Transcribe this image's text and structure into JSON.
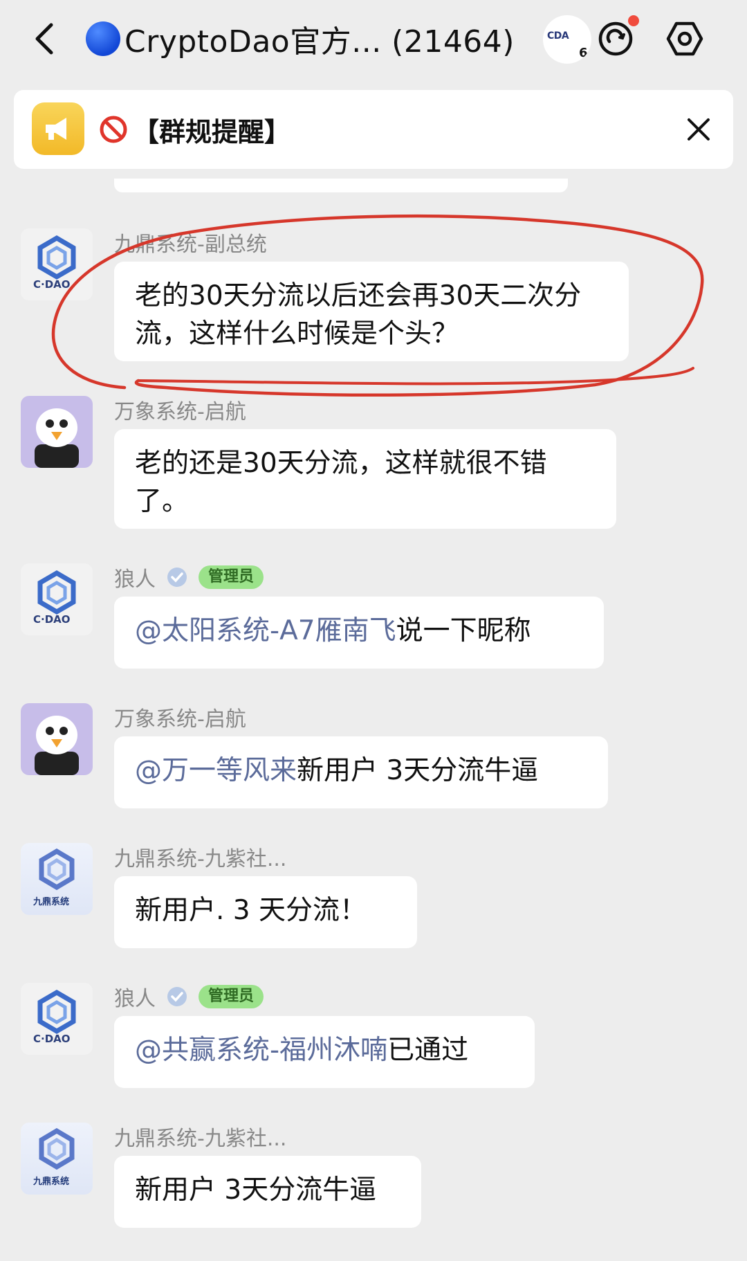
{
  "header": {
    "title": "CryptoDao官方... (21464)",
    "mini_avatar_text": "CDA",
    "mini_avatar_digit": "6"
  },
  "notice": {
    "text": "【群规提醒】"
  },
  "messages": [
    {
      "sender": "九鼎系统-副总统",
      "text": "老的30天分流以后还会再30天二次分流，这样什么时候是个头？",
      "avatar": "cdao-logo"
    },
    {
      "sender": "万象系统-启航",
      "text": "老的还是30天分流，这样就很不错了。",
      "avatar": "eagle-avatar"
    },
    {
      "sender": "狼人",
      "badge": "管理员",
      "mention": "@太阳系统-A7雁南飞",
      "text": "说一下昵称",
      "avatar": "cdao-logo"
    },
    {
      "sender": "万象系统-启航",
      "mention": "@万一等风来",
      "text": "新用户 3天分流牛逼",
      "avatar": "eagle-avatar"
    },
    {
      "sender": "九鼎系统-九紫社...",
      "text": "新用户. 3 天分流！",
      "avatar": "jiuding-logo",
      "avatar_label": "九鼎系统"
    },
    {
      "sender": "狼人",
      "badge": "管理员",
      "mention": "@共赢系统-福州沐喃",
      "text": "已通过",
      "avatar": "cdao-logo"
    },
    {
      "sender": "九鼎系统-九紫社...",
      "text": "新用户 3天分流牛逼",
      "avatar": "jiuding-logo",
      "avatar_label": "九鼎系统"
    }
  ],
  "cdao_logo_text": "C·DAO",
  "colors": {
    "background": "#ededed",
    "bubble": "#ffffff",
    "mention": "#5b6b9a",
    "admin_badge": "#9be28a",
    "annotation_red": "#d6372b",
    "red_dot": "#f04b3d"
  }
}
